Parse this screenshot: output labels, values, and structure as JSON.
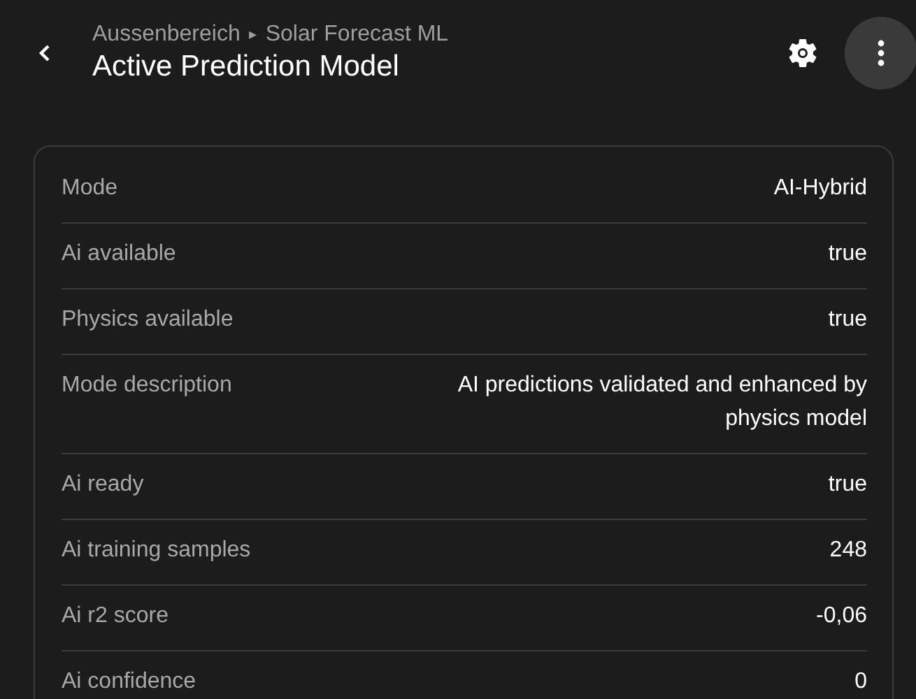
{
  "header": {
    "breadcrumb": [
      "Aussenbereich",
      "▸",
      "Solar Forecast ML"
    ],
    "title": "Active Prediction Model"
  },
  "attributes": [
    {
      "label": "Mode",
      "value": "AI-Hybrid"
    },
    {
      "label": "Ai available",
      "value": "true"
    },
    {
      "label": "Physics available",
      "value": "true"
    },
    {
      "label": "Mode description",
      "value": "AI predictions validated and enhanced by physics model"
    },
    {
      "label": "Ai ready",
      "value": "true"
    },
    {
      "label": "Ai training samples",
      "value": "248"
    },
    {
      "label": "Ai r2 score",
      "value": "-0,06"
    },
    {
      "label": "Ai confidence",
      "value": "0"
    }
  ]
}
